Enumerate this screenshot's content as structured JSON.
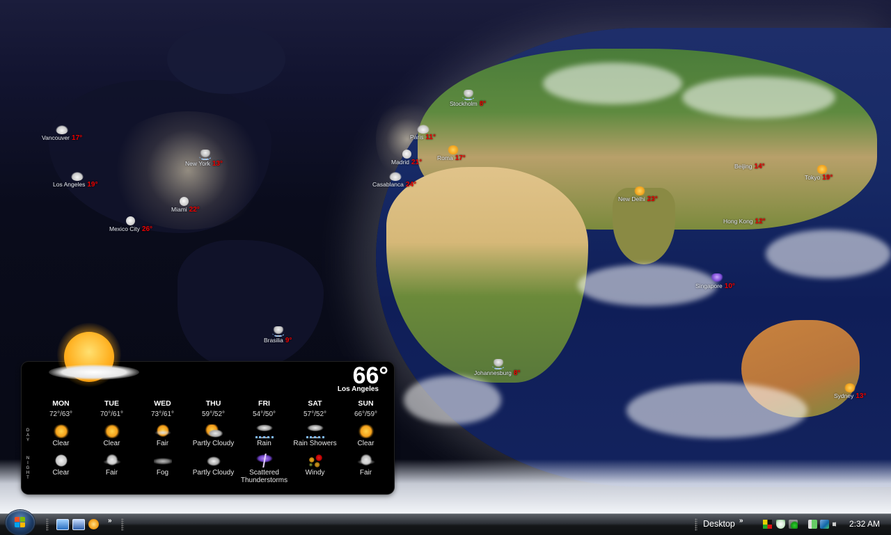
{
  "wallpaper": {
    "description": "world map with day/night terminator",
    "cities": [
      {
        "name": "Vancouver",
        "temp": "17°",
        "icon": "cloudy-icon"
      },
      {
        "name": "New York",
        "temp": "13°",
        "icon": "rain-icon"
      },
      {
        "name": "Los Angeles",
        "temp": "19°",
        "icon": "cloudy-icon"
      },
      {
        "name": "Miami",
        "temp": "22°",
        "icon": "moon-icon"
      },
      {
        "name": "Mexico City",
        "temp": "26°",
        "icon": "moon-icon"
      },
      {
        "name": "Brasilia",
        "temp": "9°",
        "icon": "rain-icon"
      },
      {
        "name": "Stockholm",
        "temp": "8°",
        "icon": "rain-icon"
      },
      {
        "name": "Paris",
        "temp": "11°",
        "icon": "cloudy-icon"
      },
      {
        "name": "Madrid",
        "temp": "21°",
        "icon": "moon-icon"
      },
      {
        "name": "Roma",
        "temp": "17°",
        "icon": "partly-cloudy-icon"
      },
      {
        "name": "Casablanca",
        "temp": "24°",
        "icon": "cloudy-icon"
      },
      {
        "name": "Johannesburg",
        "temp": "8°",
        "icon": "rain-icon"
      },
      {
        "name": "Beijing",
        "temp": "14°",
        "icon": "clear-icon"
      },
      {
        "name": "Tokyo",
        "temp": "19°",
        "icon": "sun-icon"
      },
      {
        "name": "New Delhi",
        "temp": "23°",
        "icon": "sun-icon"
      },
      {
        "name": "Hong Kong",
        "temp": "12°",
        "icon": "clear-icon"
      },
      {
        "name": "Singapore",
        "temp": "10°",
        "icon": "thunderstorm-icon"
      },
      {
        "name": "Sydney",
        "temp": "13°",
        "icon": "sun-icon"
      }
    ]
  },
  "weather_gadget": {
    "current_temp": "66°",
    "current_city": "Los Angeles",
    "current_icon": "sun-with-cloud-icon",
    "day_label": "DAY",
    "night_label": "NIGHT",
    "forecast": [
      {
        "day": "MON",
        "hilo": "72°/63°",
        "day_icon": "clear-sun-icon",
        "day_cond": "Clear",
        "night_icon": "clear-moon-icon",
        "night_cond": "Clear"
      },
      {
        "day": "TUE",
        "hilo": "70°/61°",
        "day_icon": "clear-sun-icon",
        "day_cond": "Clear",
        "night_icon": "fair-night-icon",
        "night_cond": "Fair"
      },
      {
        "day": "WED",
        "hilo": "73°/61°",
        "day_icon": "fair-day-icon",
        "day_cond": "Fair",
        "night_icon": "fog-icon",
        "night_cond": "Fog"
      },
      {
        "day": "THU",
        "hilo": "59°/52°",
        "day_icon": "partly-cloudy-day-icon",
        "day_cond": "Partly Cloudy",
        "night_icon": "partly-cloudy-night-icon",
        "night_cond": "Partly Cloudy"
      },
      {
        "day": "FRI",
        "hilo": "54°/50°",
        "day_icon": "rain-icon",
        "day_cond": "Rain",
        "night_icon": "thunderstorm-icon",
        "night_cond": "Scattered Thunderstorms"
      },
      {
        "day": "SAT",
        "hilo": "57°/52°",
        "day_icon": "rain-showers-icon",
        "day_cond": "Rain Showers",
        "night_icon": "windy-leaves-icon",
        "night_cond": "Windy"
      },
      {
        "day": "SUN",
        "hilo": "66°/59°",
        "day_icon": "clear-sun-icon",
        "day_cond": "Clear",
        "night_icon": "fair-night-icon",
        "night_cond": "Fair"
      }
    ]
  },
  "taskbar": {
    "start_button": "start-orb",
    "quick_launch": [
      {
        "name": "show-desktop",
        "icon": "show-desktop-icon"
      },
      {
        "name": "switch-windows",
        "icon": "switch-windows-icon"
      },
      {
        "name": "media-player",
        "icon": "media-player-icon"
      }
    ],
    "overflow_chevron": "»",
    "desktop_toolbar_label": "Desktop",
    "desktop_chevron": "»",
    "tray_icons": [
      "color-squares-icon",
      "security-shield-icon",
      "update-check-icon",
      "power-icon",
      "network-icon",
      "volume-icon"
    ],
    "clock": "2:32 AM"
  }
}
